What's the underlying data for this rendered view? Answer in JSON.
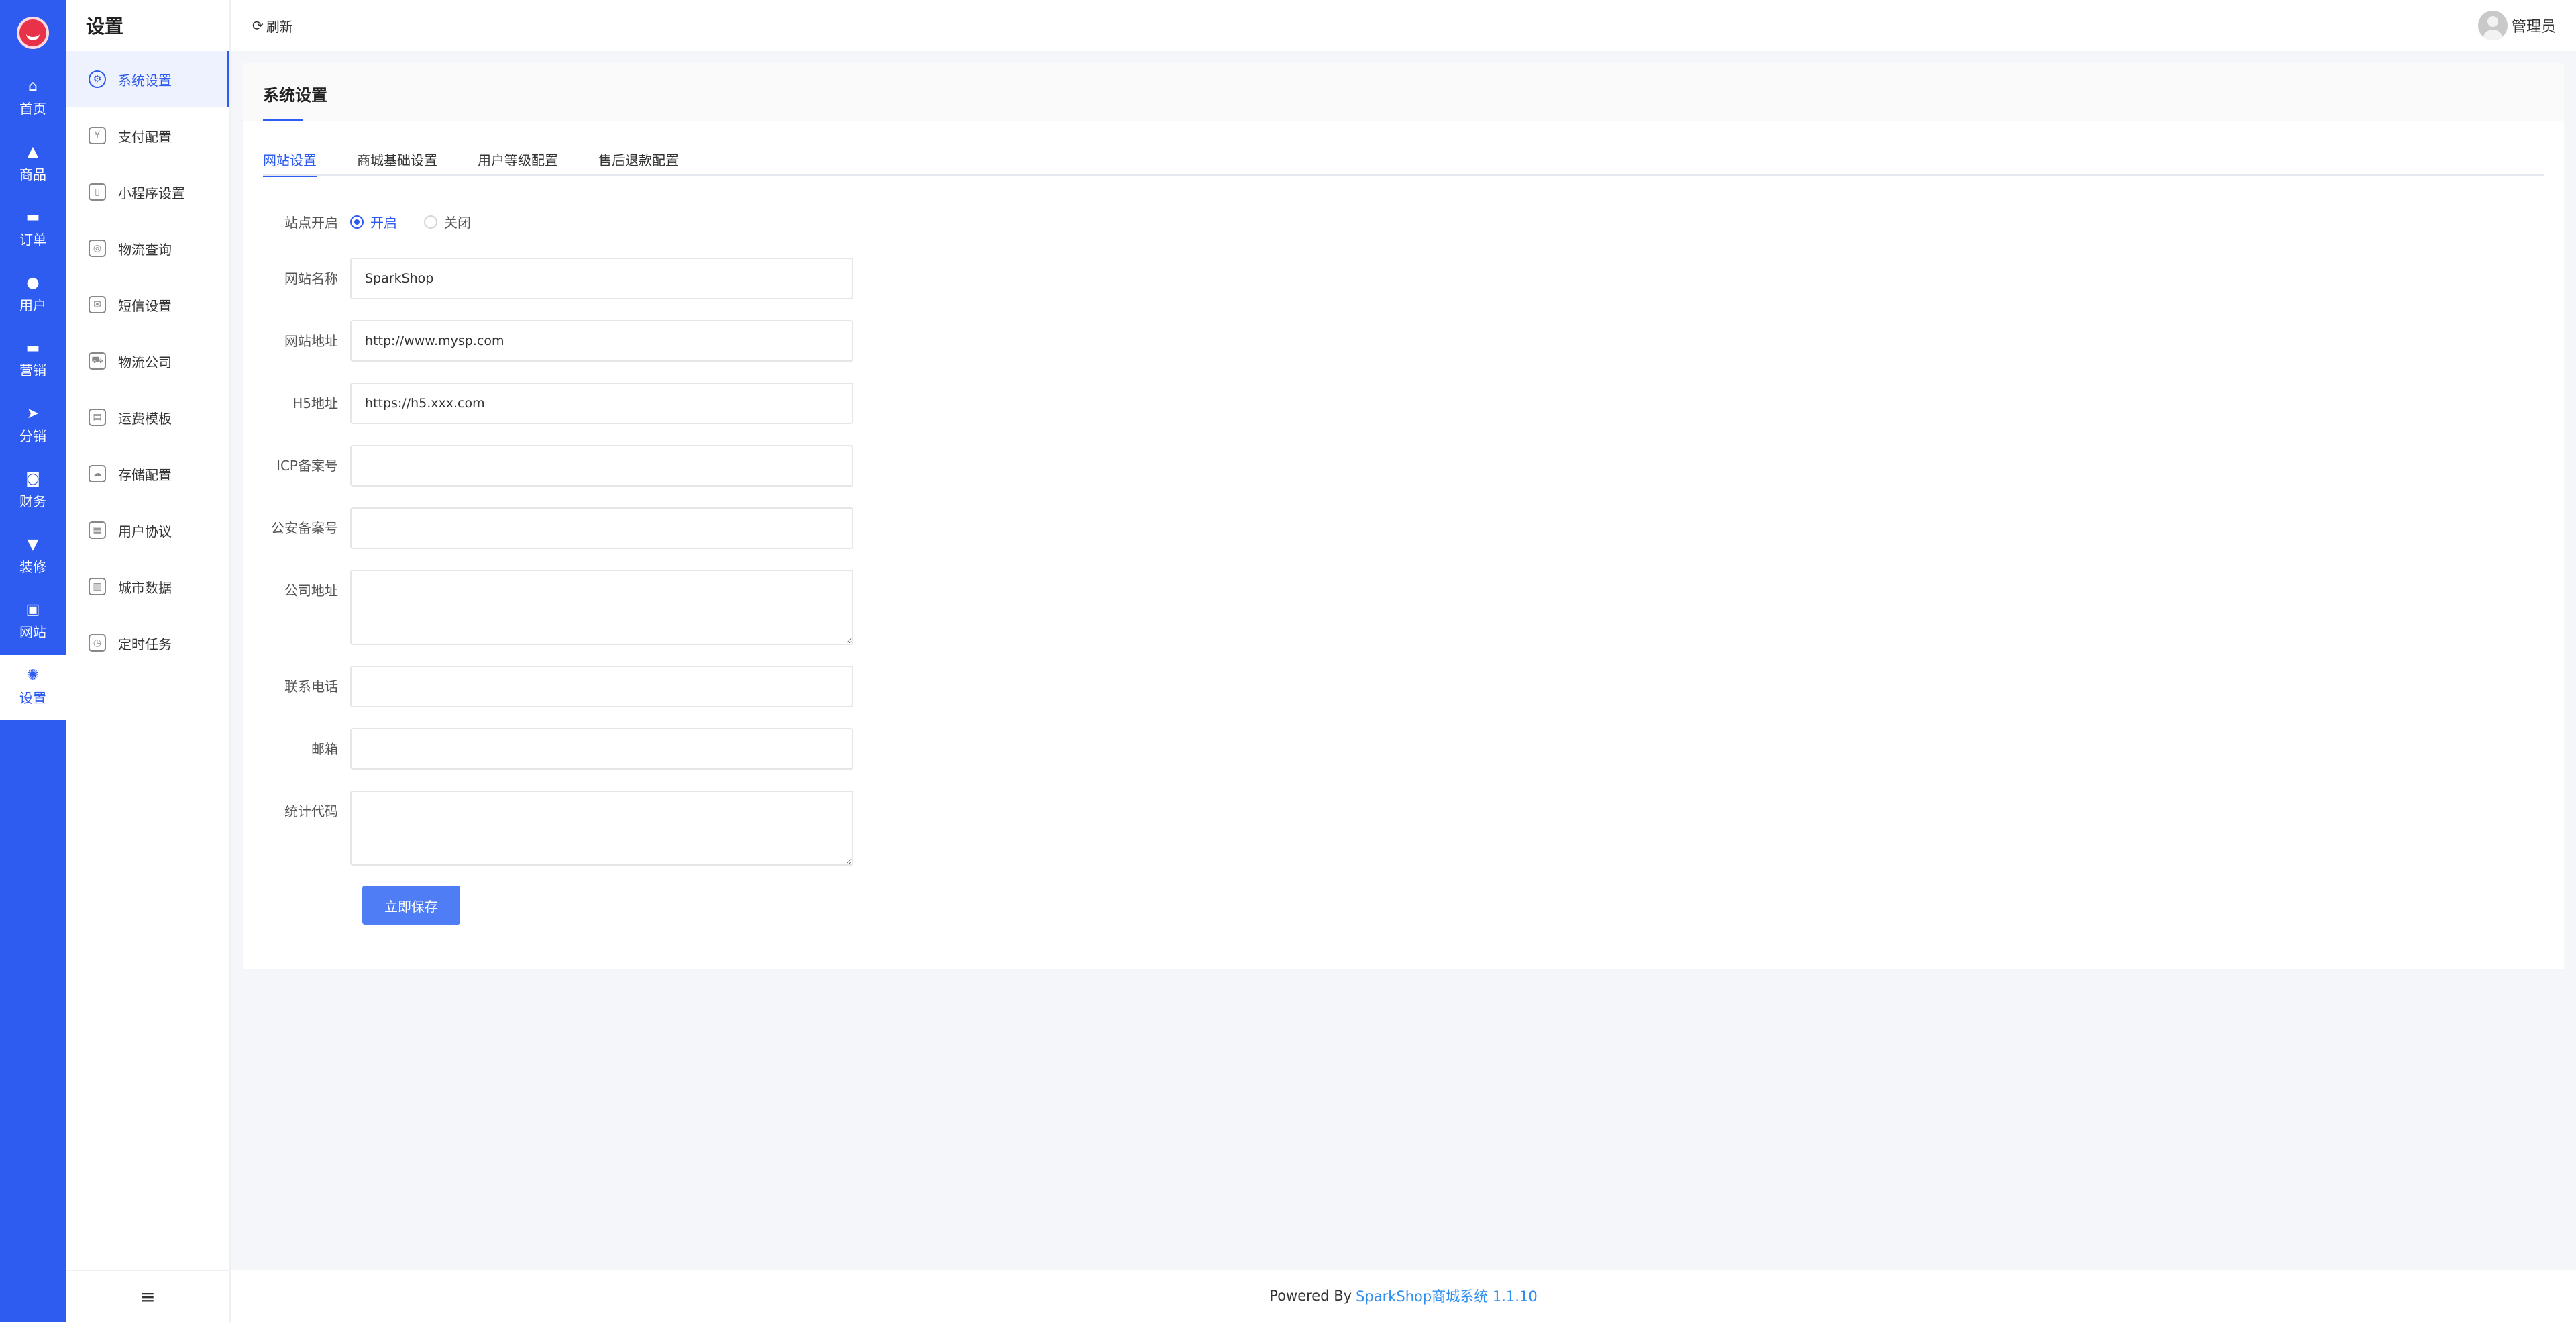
{
  "rail": {
    "items": [
      {
        "label": "首页",
        "icon": "⌂"
      },
      {
        "label": "商品",
        "icon": "▲"
      },
      {
        "label": "订单",
        "icon": "▬"
      },
      {
        "label": "用户",
        "icon": "●"
      },
      {
        "label": "营销",
        "icon": "▬"
      },
      {
        "label": "分销",
        "icon": "➤"
      },
      {
        "label": "财务",
        "icon": "◙"
      },
      {
        "label": "装修",
        "icon": "▼"
      },
      {
        "label": "网站",
        "icon": "▣"
      },
      {
        "label": "设置",
        "icon": "✺"
      }
    ],
    "active_index": 9
  },
  "submenu": {
    "title": "设置",
    "items": [
      {
        "label": "系统设置",
        "icon": "⚙"
      },
      {
        "label": "支付配置",
        "icon": "¥"
      },
      {
        "label": "小程序设置",
        "icon": "▯"
      },
      {
        "label": "物流查询",
        "icon": "◎"
      },
      {
        "label": "短信设置",
        "icon": "✉"
      },
      {
        "label": "物流公司",
        "icon": "⛟"
      },
      {
        "label": "运费模板",
        "icon": "▤"
      },
      {
        "label": "存储配置",
        "icon": "☁"
      },
      {
        "label": "用户协议",
        "icon": "▦"
      },
      {
        "label": "城市数据",
        "icon": "▥"
      },
      {
        "label": "定时任务",
        "icon": "◷"
      }
    ],
    "collapse_icon": "≡"
  },
  "topbar": {
    "refresh_label": "刷新",
    "refresh_icon": "⟳",
    "user_name": "管理员"
  },
  "panel": {
    "title": "系统设置",
    "tabs": [
      {
        "label": "网站设置"
      },
      {
        "label": "商城基础设置"
      },
      {
        "label": "用户等级配置"
      },
      {
        "label": "售后退款配置"
      }
    ],
    "form": {
      "site_open": {
        "label": "站点开启",
        "options": [
          "开启",
          "关闭"
        ],
        "selected": "开启"
      },
      "site_name": {
        "label": "网站名称",
        "value": "SparkShop"
      },
      "site_url": {
        "label": "网站地址",
        "value": "http://www.mysp.com"
      },
      "h5_url": {
        "label": "H5地址",
        "value": "https://h5.xxx.com"
      },
      "icp": {
        "label": "ICP备案号",
        "value": ""
      },
      "police": {
        "label": "公安备案号",
        "value": ""
      },
      "address": {
        "label": "公司地址",
        "value": ""
      },
      "phone": {
        "label": "联系电话",
        "value": ""
      },
      "email": {
        "label": "邮箱",
        "value": ""
      },
      "stat_code": {
        "label": "统计代码",
        "value": ""
      },
      "save_label": "立即保存"
    }
  },
  "footer": {
    "prefix": "Powered By",
    "link_text": "SparkShop商城系统 1.1.10"
  },
  "colors": {
    "primary": "#2e5bf0",
    "button": "#4f7df5"
  }
}
